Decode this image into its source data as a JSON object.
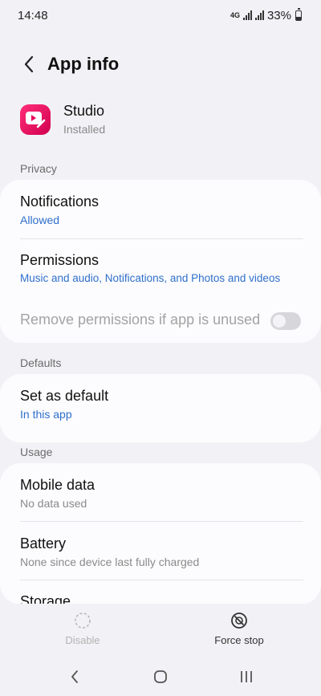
{
  "status_bar": {
    "time": "14:48",
    "battery": "33%",
    "network_up": "4G",
    "network_down": "+"
  },
  "header": {
    "title": "App info",
    "back_icon": "chevron-left-icon"
  },
  "app": {
    "name": "Studio",
    "status": "Installed",
    "icon": "studio-app-icon",
    "icon_color": "#e8005f"
  },
  "sections": {
    "privacy": {
      "label": "Privacy",
      "notifications": {
        "title": "Notifications",
        "value": "Allowed"
      },
      "permissions": {
        "title": "Permissions",
        "value": "Music and audio, Notifications, and Photos and videos"
      },
      "remove_permissions": {
        "title": "Remove permissions if app is unused",
        "enabled": false
      }
    },
    "defaults": {
      "label": "Defaults",
      "set_as_default": {
        "title": "Set as default",
        "value": "In this app"
      }
    },
    "usage": {
      "label": "Usage",
      "mobile_data": {
        "title": "Mobile data",
        "value": "No data used"
      },
      "battery": {
        "title": "Battery",
        "value": "None since device last fully charged"
      },
      "storage": {
        "title": "Storage"
      }
    }
  },
  "actions": {
    "disable": {
      "label": "Disable",
      "enabled": false
    },
    "force_stop": {
      "label": "Force stop",
      "enabled": true
    }
  },
  "nav": {
    "back": "back-icon",
    "home": "home-icon",
    "recents": "recents-icon"
  },
  "colors": {
    "accent_blue": "#2f6fcb",
    "background": "#f2f2f6",
    "card": "#fcfcfe"
  }
}
